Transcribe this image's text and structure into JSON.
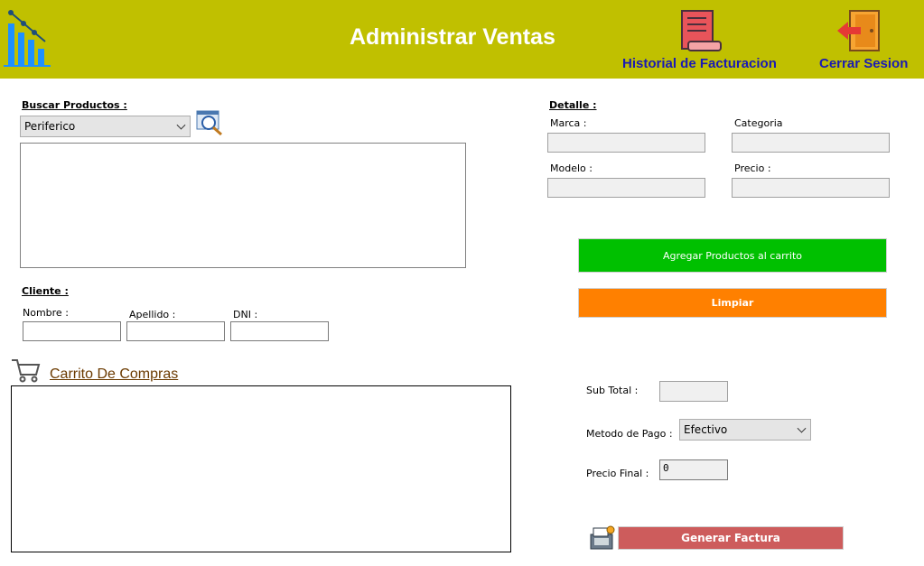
{
  "header": {
    "title": "Administrar Ventas",
    "history_label": "Historial de Facturacion",
    "logout_label": "Cerrar Sesion"
  },
  "search": {
    "label": "Buscar Productos :",
    "category_selected": "Periferico"
  },
  "detail": {
    "label": "Detalle :",
    "marca_label": "Marca :",
    "categoria_label": "Categoria",
    "modelo_label": "Modelo :",
    "precio_label": "Precio :"
  },
  "actions": {
    "add_to_cart": "Agregar Productos al carrito",
    "clear": "Limpiar",
    "generate_invoice": "Generar Factura"
  },
  "client": {
    "label": "Cliente :",
    "nombre_label": "Nombre :",
    "apellido_label": "Apellido :",
    "dni_label": "DNI :"
  },
  "cart": {
    "label": "Carrito De Compras"
  },
  "summary": {
    "subtotal_label": "Sub Total  :",
    "payment_label": "Metodo de Pago :",
    "payment_selected": "Efectivo",
    "final_label": "Precio Final :",
    "final_value": "0"
  },
  "colors": {
    "header_bg": "#c0c000",
    "add_button": "#00c000",
    "clear_button": "#ff8000",
    "invoice_button": "#cd5c5c",
    "header_link": "#1a1ab4"
  }
}
